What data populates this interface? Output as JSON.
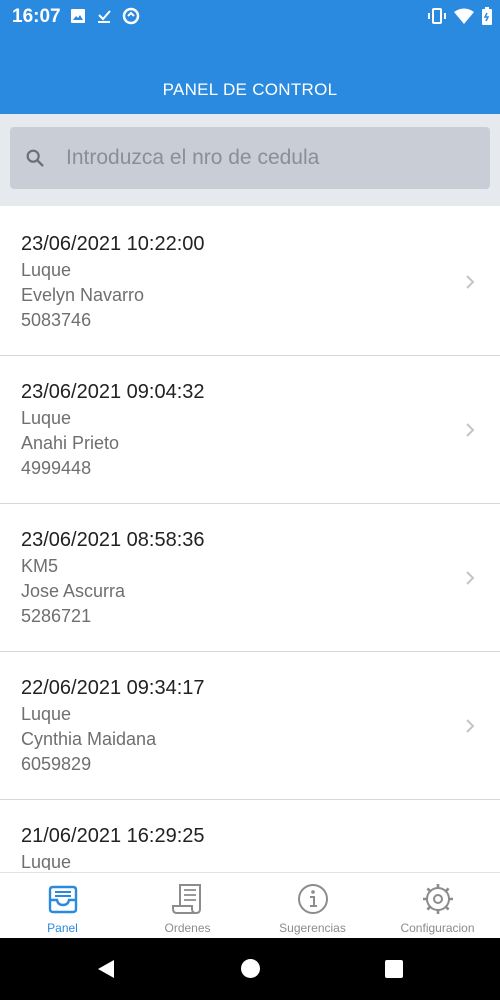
{
  "status_bar": {
    "time": "16:07"
  },
  "header": {
    "title": "PANEL DE CONTROL"
  },
  "search": {
    "placeholder": "Introduzca el nro de cedula",
    "value": ""
  },
  "records": [
    {
      "datetime": "23/06/2021 10:22:00",
      "location": "Luque",
      "name": "Evelyn Navarro",
      "cedula": "5083746"
    },
    {
      "datetime": "23/06/2021 09:04:32",
      "location": "Luque",
      "name": "Anahi Prieto",
      "cedula": "4999448"
    },
    {
      "datetime": "23/06/2021 08:58:36",
      "location": "KM5",
      "name": "Jose Ascurra",
      "cedula": "5286721"
    },
    {
      "datetime": "22/06/2021 09:34:17",
      "location": "Luque",
      "name": "Cynthia Maidana",
      "cedula": "6059829"
    },
    {
      "datetime": "21/06/2021 16:29:25",
      "location": "Luque",
      "name": "",
      "cedula": ""
    }
  ],
  "bottom_nav": {
    "tabs": [
      {
        "label": "Panel",
        "icon": "inbox-icon",
        "active": true
      },
      {
        "label": "Ordenes",
        "icon": "receipt-icon",
        "active": false
      },
      {
        "label": "Sugerencias",
        "icon": "info-icon",
        "active": false
      },
      {
        "label": "Configuracion",
        "icon": "gear-icon",
        "active": false
      }
    ]
  },
  "colors": {
    "primary": "#2a8ae0",
    "search_bg": "#c9ced6",
    "text_secondary": "#6f6f6f"
  }
}
